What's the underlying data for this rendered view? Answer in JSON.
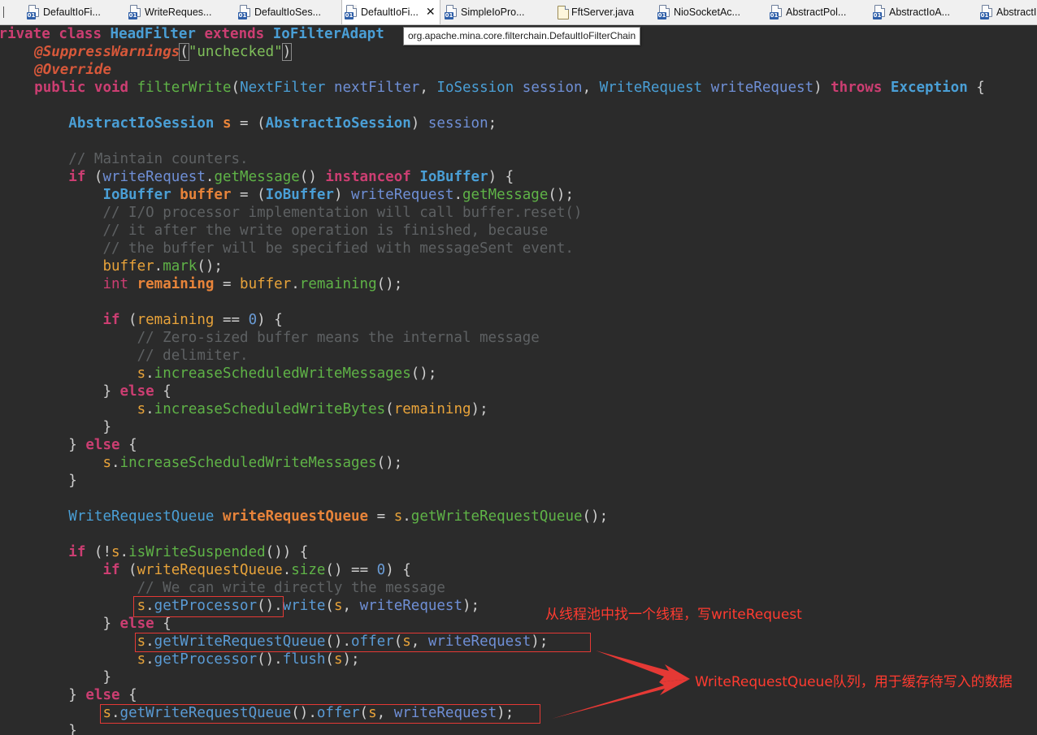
{
  "tabs": [
    {
      "label": "DefaultIoFi...",
      "active": false,
      "icon": "java-class-icon"
    },
    {
      "label": "WriteReques...",
      "active": false,
      "icon": "java-class-icon"
    },
    {
      "label": "DefaultIoSes...",
      "active": false,
      "icon": "java-class-icon"
    },
    {
      "label": "DefaultIoFi...",
      "active": true,
      "icon": "java-class-icon",
      "close": "✕"
    },
    {
      "label": "SimpleIoPro...",
      "active": false,
      "icon": "java-class-icon"
    },
    {
      "label": "FftServer.java",
      "active": false,
      "icon": "java-file-icon"
    },
    {
      "label": "NioSocketAc...",
      "active": false,
      "icon": "java-class-icon"
    },
    {
      "label": "AbstractPol...",
      "active": false,
      "icon": "java-class-icon"
    },
    {
      "label": "AbstractIoA...",
      "active": false,
      "icon": "java-class-icon"
    },
    {
      "label": "AbstractI",
      "active": false,
      "icon": "java-class-icon"
    }
  ],
  "tooltip": "org.apache.mina.core.filterchain.DefaultIoFilterChain",
  "code": {
    "l1": {
      "kw1": "private",
      "kw2": "class",
      "name": "HeadFilter",
      "kw3": "extends",
      "super": "IoFilterAdapt"
    },
    "l2": {
      "ann": "@SuppressWarnings",
      "open": "(",
      "str": "\"unchecked\"",
      "close": ")"
    },
    "l3": {
      "ann": "@Override"
    },
    "l4": {
      "kw1": "public",
      "kw2": "void",
      "meth": "filterWrite",
      "p1t": "NextFilter",
      "p1": "nextFilter",
      "p2t": "IoSession",
      "p2": "session",
      "p3t": "WriteRequest",
      "p3": "writeRequest",
      "throws": "throws",
      "ex": "Exception"
    },
    "l6": {
      "t1": "AbstractIoSession",
      "var": "s",
      "t2": "AbstractIoSession",
      "src": "session"
    },
    "l8": {
      "comment": "// Maintain counters."
    },
    "l9": {
      "kw": "if",
      "obj": "writeRequest",
      "call": "getMessage",
      "kw2": "instanceof",
      "type": "IoBuffer"
    },
    "l10": {
      "type": "IoBuffer",
      "var": "buffer",
      "cast": "IoBuffer",
      "obj": "writeRequest",
      "call": "getMessage"
    },
    "l11": {
      "comment": "// I/O processor implementation will call buffer.reset()"
    },
    "l12": {
      "comment": "// it after the write operation is finished, because"
    },
    "l13": {
      "comment": "// the buffer will be specified with messageSent event."
    },
    "l14": {
      "obj": "buffer",
      "call": "mark"
    },
    "l15": {
      "kw": "int",
      "var": "remaining",
      "obj": "buffer",
      "call": "remaining"
    },
    "l17": {
      "kw": "if",
      "var": "remaining",
      "num": "0"
    },
    "l18": {
      "comment": "// Zero-sized buffer means the internal message"
    },
    "l19": {
      "comment": "// delimiter."
    },
    "l20": {
      "obj": "s",
      "call": "increaseScheduledWriteMessages"
    },
    "l21": {
      "kw": "else"
    },
    "l22": {
      "obj": "s",
      "call": "increaseScheduledWriteBytes",
      "arg": "remaining"
    },
    "l24": {
      "kw": "else"
    },
    "l25": {
      "obj": "s",
      "call": "increaseScheduledWriteMessages"
    },
    "l28": {
      "type": "WriteRequestQueue",
      "var": "writeRequestQueue",
      "obj": "s",
      "call": "getWriteRequestQueue"
    },
    "l30": {
      "kw": "if",
      "obj": "s",
      "call": "isWriteSuspended"
    },
    "l31": {
      "kw": "if",
      "obj": "writeRequestQueue",
      "call": "size",
      "num": "0"
    },
    "l32": {
      "comment": "// We can write directly the message"
    },
    "l33": {
      "obj": "s",
      "call": "getProcessor",
      "call2": "write",
      "a1": "s",
      "a2": "writeRequest"
    },
    "l34": {
      "kw": "else"
    },
    "l35": {
      "obj": "s",
      "call": "getWriteRequestQueue",
      "call2": "offer",
      "a1": "s",
      "a2": "writeRequest"
    },
    "l36": {
      "obj": "s",
      "call": "getProcessor",
      "call2": "flush",
      "a1": "s"
    },
    "l38": {
      "kw": "else"
    },
    "l39": {
      "obj": "s",
      "call": "getWriteRequestQueue",
      "call2": "offer",
      "a1": "s",
      "a2": "writeRequest"
    }
  },
  "annotations": {
    "thread_pool_note": "从线程池中找一个线程，写writeRequest",
    "queue_note": "WriteRequestQueue队列，用于缓存待写入的数据",
    "color": "#ff3b30"
  }
}
